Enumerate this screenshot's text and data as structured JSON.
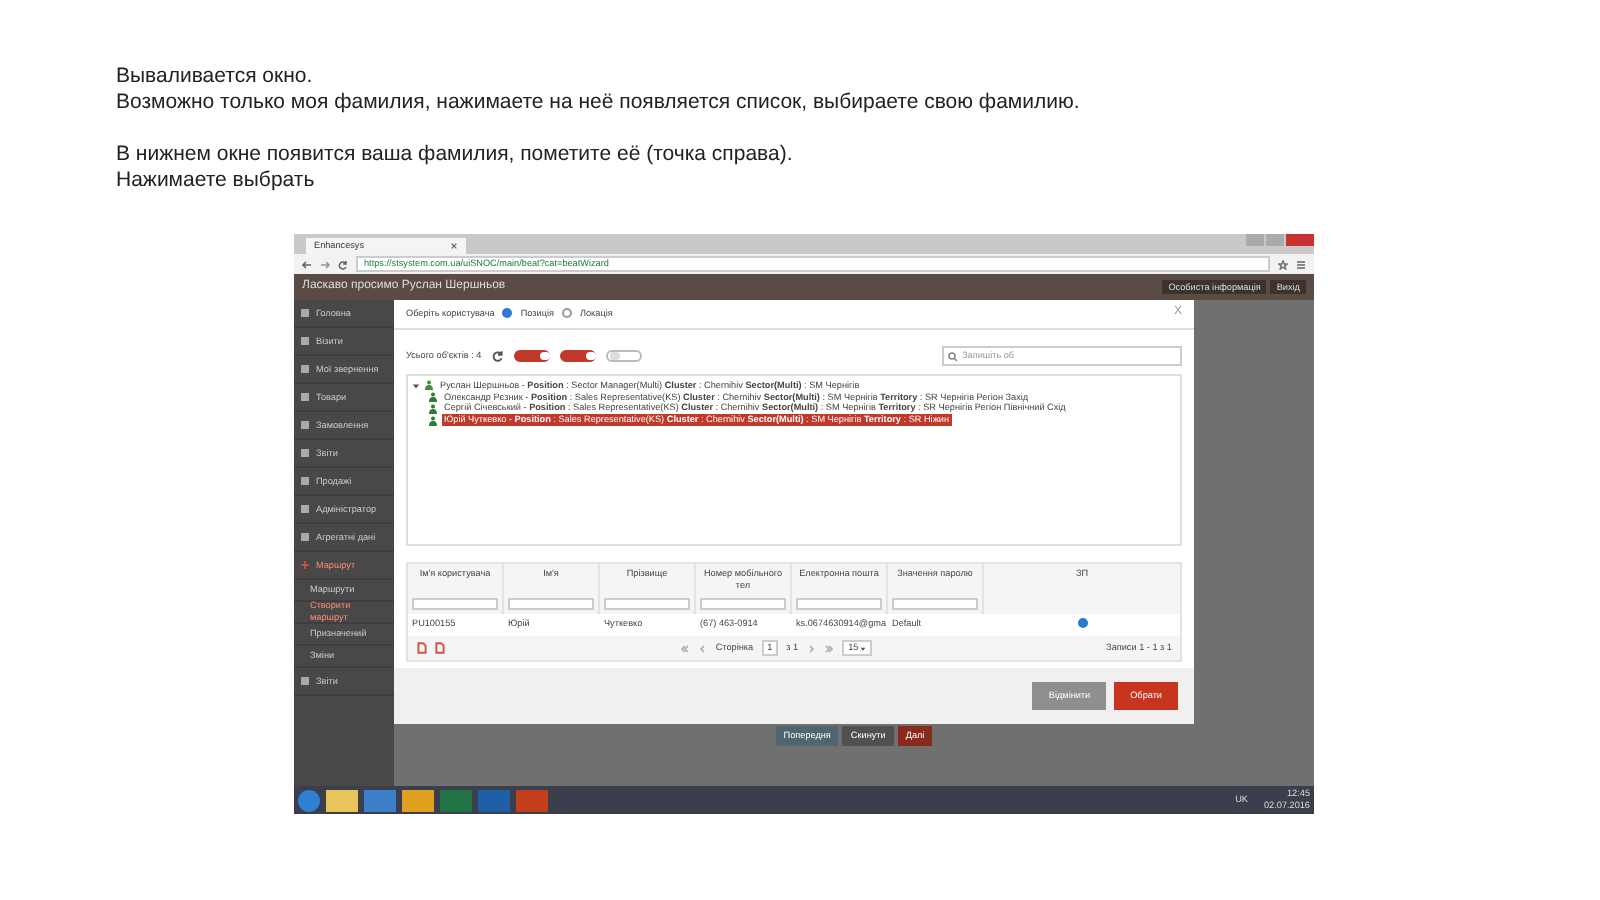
{
  "instructions": [
    [
      "Вываливается окно.",
      "Возможно только моя фамилия, нажимаете на неё появляется список, выбираете свою фамилию."
    ],
    [
      "В нижнем окне появится ваша фамилия, пометите её (точка справа).",
      "Нажимаете выбрать"
    ]
  ],
  "browser": {
    "tab_title": "Enhancesys",
    "url": "https://stsystem.com.ua/uiSNOC/main/beat?cat=beatWizard"
  },
  "app": {
    "header": "Ласкаво просимо Руслан Шершньов",
    "header_buttons": [
      "Особиста інформація",
      "Вихід"
    ],
    "sidebar": [
      {
        "label": "Головна",
        "selected": false
      },
      {
        "label": "Візити",
        "selected": false
      },
      {
        "label": "Мої звернення",
        "selected": false
      },
      {
        "label": "Товари",
        "selected": false
      },
      {
        "label": "Замовлення",
        "selected": false
      },
      {
        "label": "Звіти",
        "selected": false
      },
      {
        "label": "Продажі",
        "selected": false
      },
      {
        "label": "Адміністратор",
        "selected": false
      },
      {
        "label": "Агрегатні дані",
        "selected": false
      },
      {
        "label": "Маршрут",
        "selected": true,
        "children": [
          {
            "label": "Маршрути",
            "selected": false
          },
          {
            "label": "Створити маршрут",
            "selected": true
          },
          {
            "label": "Призначений",
            "selected": false
          },
          {
            "label": "Зміни",
            "selected": false
          }
        ]
      },
      {
        "label": "Звіти",
        "selected": false
      }
    ],
    "footer_buttons": [
      {
        "label": "Попередня",
        "kind": "back"
      },
      {
        "label": "Скинути",
        "kind": "reset"
      },
      {
        "label": "Далі",
        "kind": "next"
      }
    ]
  },
  "modal": {
    "title": "Оберіть користувача",
    "close": "X",
    "radios": [
      {
        "label": "Позиція",
        "selected": true
      },
      {
        "label": "Локація",
        "selected": false
      }
    ],
    "count": "Усього об'єктів : 4",
    "toggles": [
      {
        "on": true
      },
      {
        "on": true
      },
      {
        "on": false
      }
    ],
    "search": {
      "placeholder": "Запишіть об"
    },
    "tree": [
      {
        "text": "Руслан Шершньов - **Position** : Sector Manager(Multi) **Cluster** : Chernihiv **Sector(Multi)** : SM Чернігів",
        "selected": false,
        "expanded": true,
        "children": [
          {
            "text": "Олександр Рєзник - **Position** : Sales Representative(KS) **Cluster** : Chernihiv **Sector(Multi)** : SM Чернігів **Territory** : SR Чернігів Регіон Захід",
            "selected": false
          },
          {
            "text": "Сергій Січевський - **Position** : Sales Representative(KS) **Cluster** : Chernihiv **Sector(Multi)** : SM Чернігів **Territory** : SR Чернігів Регіон Північний Схід",
            "selected": false
          },
          {
            "text": "Юрій Чуткевко - **Position** : Sales Representative(KS) **Cluster** : Chernihiv **Sector(Multi)** : SM Чернігів **Territory** : SR Ніжин",
            "selected": true
          }
        ]
      }
    ],
    "table": {
      "columns": [
        "Ім'я користувача",
        "Ім'я",
        "Прізвище",
        "Номер мобільного тел",
        "Електронна пошта",
        "Значення паролю",
        "ЗП"
      ],
      "rows": [
        {
          "cells": [
            "PU100155",
            "Юрій",
            "Чуткевко",
            "(67) 463-0914",
            "ks.0674630914@gma",
            "Default"
          ],
          "selected": true
        }
      ],
      "pager": {
        "page_label": "Сторінка",
        "page": "1",
        "of": "з 1",
        "per_page": "15",
        "records": "Записи 1 - 1 з 1"
      }
    },
    "buttons": [
      {
        "label": "Відмінити",
        "kind": "cancel"
      },
      {
        "label": "Обрати",
        "kind": "primary"
      }
    ]
  },
  "taskbar": {
    "language": "UK",
    "time": "12:45",
    "date": "02.07.2016"
  }
}
